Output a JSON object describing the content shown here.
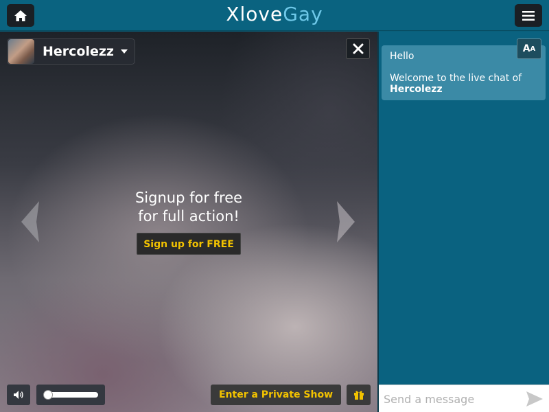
{
  "header": {
    "logo_main": "Xlove",
    "logo_accent": "Gay",
    "home_icon": "home-icon",
    "menu_icon": "hamburger-menu-icon"
  },
  "performer": {
    "name": "Hercolezz",
    "avatar_icon": "performer-avatar"
  },
  "video": {
    "signup_text_line1": "Signup for free",
    "signup_text_line2": "for full action!",
    "signup_button": "Sign up for FREE",
    "private_show_button": "Enter a Private Show",
    "volume_level": 0
  },
  "chat": {
    "font_button_big": "A",
    "font_button_small": "A",
    "messages": [
      {
        "greeting": "Hello",
        "welcome": "Welcome to the live chat of",
        "performer": "Hercolezz"
      }
    ],
    "input_placeholder": "Send a message"
  },
  "colors": {
    "header_bg": "#0a6380",
    "chat_bg": "#0a6280",
    "message_bg": "#3b8aa6",
    "cta_yellow": "#f2c200",
    "button_dark": "#1a1f24"
  }
}
